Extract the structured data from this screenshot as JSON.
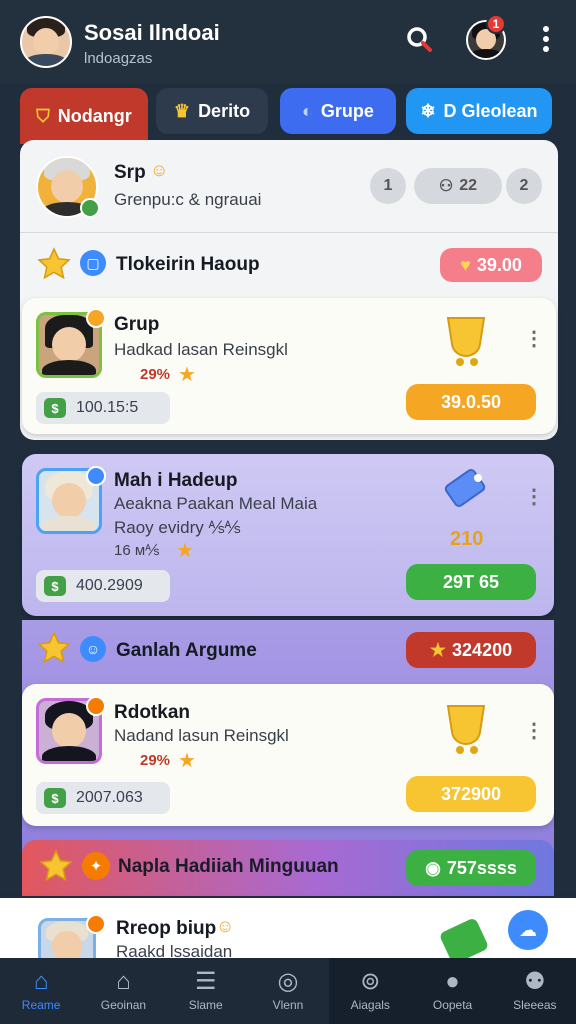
{
  "header": {
    "title": "Sosai Ilndoai",
    "subtitle": "lndoagzas",
    "notification_count": "1"
  },
  "tabs": [
    {
      "label": "Nodangr",
      "icon": "shield-icon"
    },
    {
      "label": "Derito",
      "icon": "crown-icon"
    },
    {
      "label": "Grupe",
      "icon": "wave-icon"
    },
    {
      "label": "D Gleolean",
      "icon": "snowflake-icon"
    }
  ],
  "profile": {
    "name": "Srp",
    "subtitle": "Grenpu:c & ngrauai",
    "counters": [
      "1",
      "22",
      "2"
    ]
  },
  "section1": {
    "title": "Tlokeirin Haoup",
    "value": "39.00"
  },
  "cards": [
    {
      "name": "Grup",
      "line1": "Hadkad lasan Reinsgkl",
      "line2": "29%",
      "stat": "100.15:5",
      "action": "39.0.50"
    },
    {
      "name": "Mah i Hadeup",
      "line1": "Aeakna Paakan Meal Maia",
      "line2": "Raoy evidry ⅍⅍",
      "line3": "16 м⅍",
      "stat": "400.2909",
      "highlight": "210",
      "action": "29T 65"
    },
    {
      "name": "Rdotkan",
      "line1": "Nadand lasun Reinsgkl",
      "line2": "29%",
      "stat": "2007.063",
      "action": "372900"
    }
  ],
  "section2": {
    "title": "Ganlah Argume",
    "value": "324200"
  },
  "section3": {
    "title": "Napla Hadiiah Minguuan",
    "value": "757ssss"
  },
  "peek_card": {
    "name": "Rreop biup",
    "line1": "Raakd lssaidan"
  },
  "nav": [
    {
      "label": "Reame",
      "icon": "home-icon"
    },
    {
      "label": "Geoinan",
      "icon": "house-icon"
    },
    {
      "label": "Slame",
      "icon": "list-icon"
    },
    {
      "label": "Vlenn",
      "icon": "compass-icon"
    },
    {
      "label": "Aiagals",
      "icon": "search-circle-icon"
    },
    {
      "label": "Oopeta",
      "icon": "person-icon"
    },
    {
      "label": "Sleeeas",
      "icon": "people-icon"
    }
  ],
  "colors": {
    "tab_red": "#c0392b",
    "tab_dark": "#2d3b4c",
    "tab_blue": "#3d6cf0",
    "tab_cyan": "#2196f3",
    "orange_button": "#f5a623",
    "green_button": "#3cb043",
    "yellow_button": "#f7c531"
  }
}
